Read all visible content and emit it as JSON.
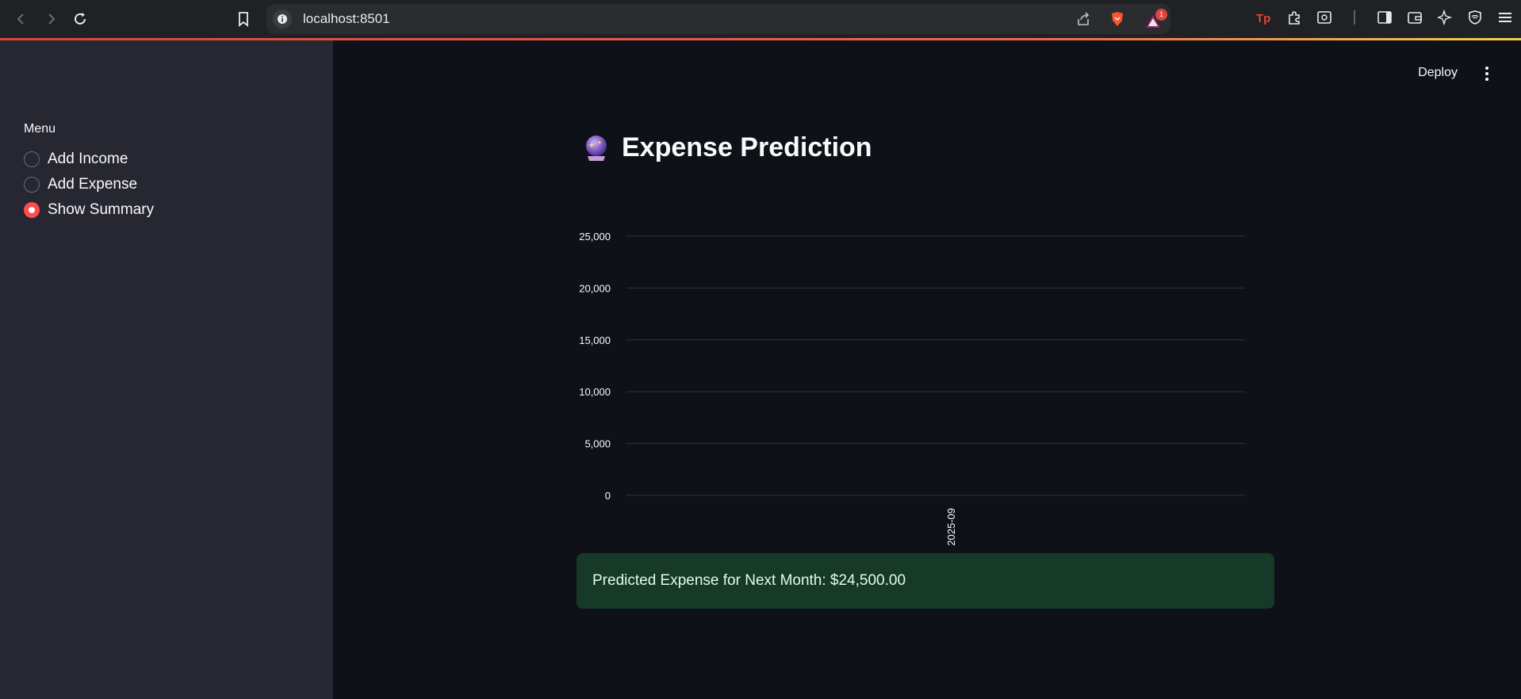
{
  "browser": {
    "url": "localhost:8501",
    "notification_count": "1"
  },
  "sidebar": {
    "menu_label": "Menu",
    "options": [
      {
        "label": "Add Income",
        "selected": false
      },
      {
        "label": "Add Expense",
        "selected": false
      },
      {
        "label": "Show Summary",
        "selected": true
      }
    ]
  },
  "header": {
    "deploy_label": "Deploy"
  },
  "main": {
    "title": "Expense Prediction",
    "title_icon": "crystal-ball-icon",
    "prediction_message": "Predicted Expense for Next Month: $24,500.00"
  },
  "colors": {
    "accent": "#ff4b4b",
    "success_bg": "#173928",
    "success_text": "#dffde9"
  },
  "chart_data": {
    "type": "bar",
    "categories": [
      "2025-09"
    ],
    "values": [
      0
    ],
    "y_ticks": [
      "0",
      "5,000",
      "10,000",
      "15,000",
      "20,000",
      "25,000"
    ],
    "ylim": [
      0,
      25000
    ],
    "grid": true
  }
}
